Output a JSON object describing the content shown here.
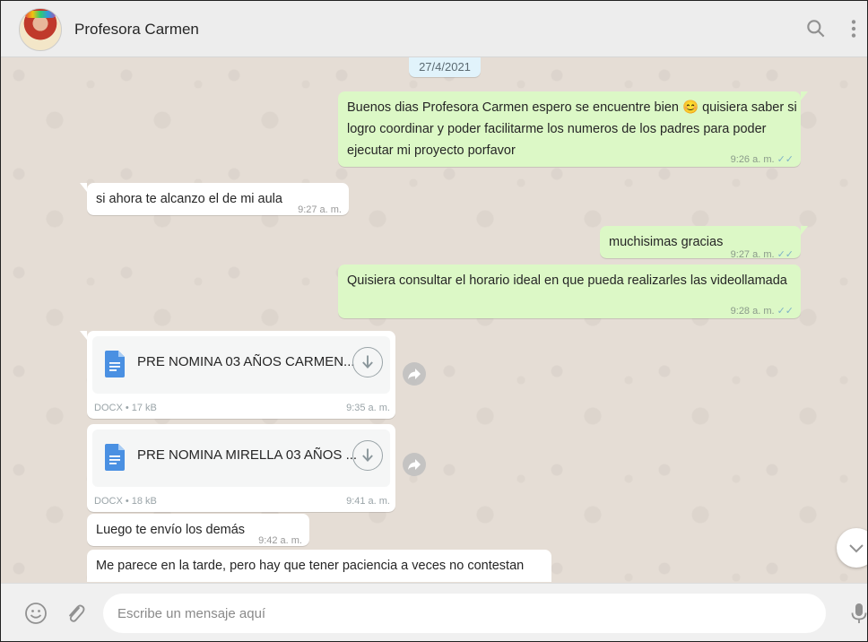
{
  "header": {
    "contact_name": "Profesora Carmen",
    "icons": [
      "search-icon",
      "menu-icon"
    ]
  },
  "chat": {
    "date_chip": "27/4/2021",
    "messages": [
      {
        "dir": "out",
        "lines": [
          "Buenos dias Profesora Carmen espero se encuentre bien 😊 quisiera saber si",
          "logro coordinar y poder facilitarme los numeros de los padres para poder",
          "ejecutar mi proyecto porfavor"
        ],
        "time": "9:26 a. m.",
        "read": true
      },
      {
        "dir": "in",
        "lines": [
          "si ahora te alcanzo el de mi aula"
        ],
        "time": "9:27 a. m."
      },
      {
        "dir": "out",
        "lines": [
          "muchisimas gracias"
        ],
        "time": "9:27 a. m.",
        "read": true
      },
      {
        "dir": "out",
        "lines": [
          "Quisiera consultar el horario ideal en que pueda realizarles las videollamada"
        ],
        "time": "9:28 a. m.",
        "read": true
      },
      {
        "dir": "in",
        "type": "document",
        "file_name": "PRE NOMINA 03 AÑOS CARMEN...",
        "info": "DOCX • 17 kB",
        "time": "9:35 a. m."
      },
      {
        "dir": "in",
        "type": "document",
        "file_name": "PRE NOMINA MIRELLA 03 AÑOS ...",
        "info": "DOCX • 18 kB",
        "time": "9:41 a. m."
      },
      {
        "dir": "in",
        "lines": [
          "Luego te envío los demás"
        ],
        "time": "9:42 a. m."
      },
      {
        "dir": "in",
        "lines": [
          "Me parece en la tarde, pero hay que tener paciencia a veces no contestan"
        ],
        "time": ""
      }
    ]
  },
  "footer": {
    "input_placeholder": "Escribe un mensaje aquí",
    "icons": [
      "emoji-icon",
      "attach-icon",
      "mic-icon"
    ]
  },
  "colors": {
    "outgoing_bubble": "#dcf8c6",
    "incoming_bubble": "#ffffff",
    "chat_background": "#e5ddd5",
    "read_ticks": "#7fb2c7",
    "doc_icon": "#4a90e2"
  }
}
